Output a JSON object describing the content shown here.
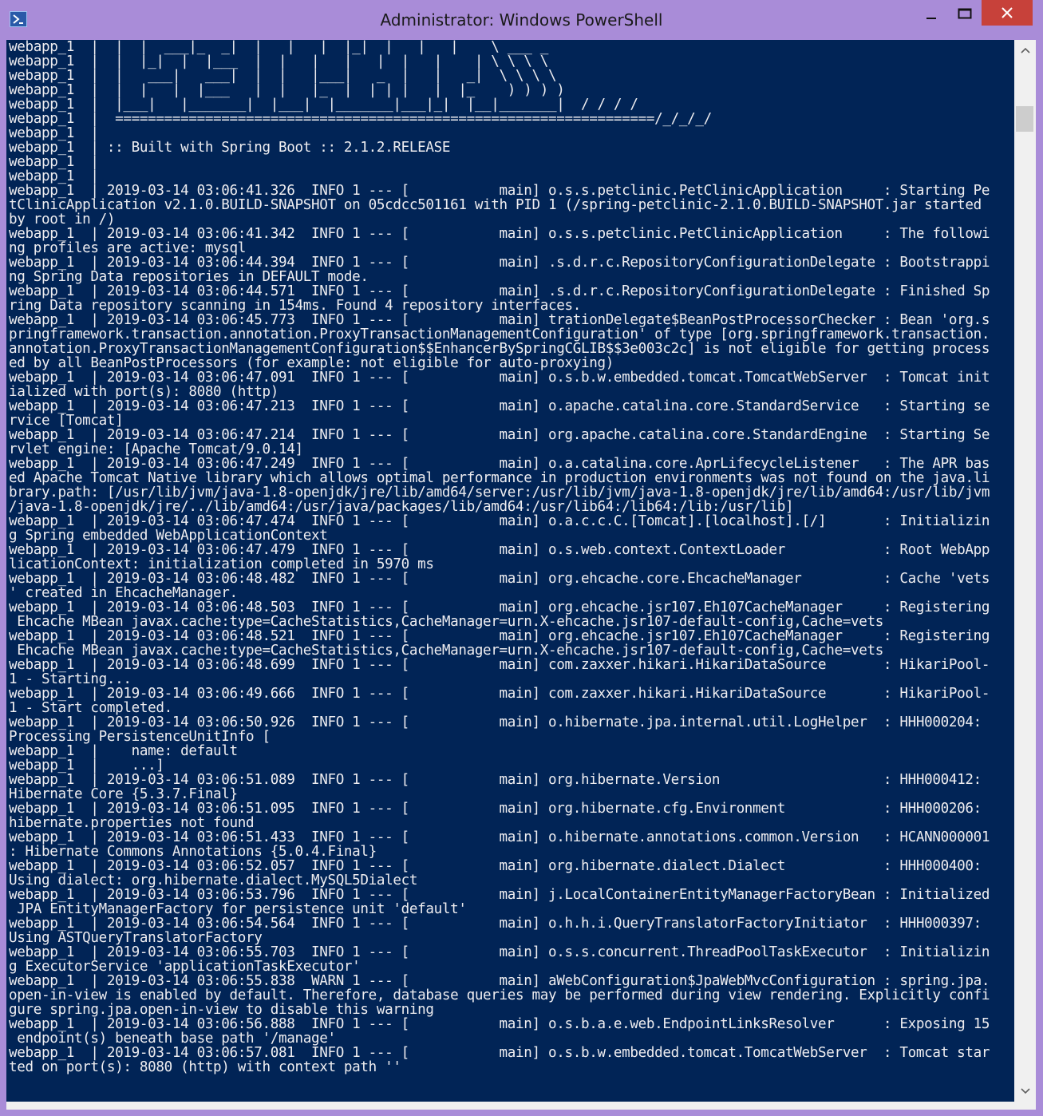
{
  "window": {
    "title": "Administrator: Windows PowerShell",
    "frame_color": "#a98cd8",
    "console_background": "#012456",
    "console_foreground": "#eeedf0",
    "close_color": "#c7413a"
  },
  "icons": {
    "app": "powershell-icon",
    "minimize": "minimize-icon",
    "maximize": "maximize-icon",
    "close": "close-icon",
    "scroll_up": "chevron-up-icon",
    "scroll_down": "chevron-down-icon"
  },
  "console_lines": [
    "webapp_1  |  |  |  ___|_  _|  |   |   |  |_|  |   |   |    \\ ___ _",
    "webapp_1  |  |  |_|  |  |___  |  |   |   |   |  |   |    | \\ \\ \\ \\",
    "webapp_1  |  |   ___|   ___|  |  |   |___|   _  |   |   _|  \\ \\ \\ \\",
    "webapp_1  |  |  |   |  |___   |  |   |_  |  | | |   |  |_    ) ) ) )",
    "webapp_1  |  |___|   |_______|  |___|  |_______|___|_|  |__|_______|  / / / /",
    "webapp_1  |  ==================================================================/_/_/_/",
    "webapp_1  |",
    "webapp_1  | :: Built with Spring Boot :: 2.1.2.RELEASE",
    "webapp_1  |",
    "webapp_1  |",
    "webapp_1  | 2019-03-14 03:06:41.326  INFO 1 --- [           main] o.s.s.petclinic.PetClinicApplication     : Starting Pe",
    "tClinicApplication v2.1.0.BUILD-SNAPSHOT on 05cdcc501161 with PID 1 (/spring-petclinic-2.1.0.BUILD-SNAPSHOT.jar started",
    "by root in /)",
    "webapp_1  | 2019-03-14 03:06:41.342  INFO 1 --- [           main] o.s.s.petclinic.PetClinicApplication     : The followi",
    "ng profiles are active: mysql",
    "webapp_1  | 2019-03-14 03:06:44.394  INFO 1 --- [           main] .s.d.r.c.RepositoryConfigurationDelegate : Bootstrappi",
    "ng Spring Data repositories in DEFAULT mode.",
    "webapp_1  | 2019-03-14 03:06:44.571  INFO 1 --- [           main] .s.d.r.c.RepositoryConfigurationDelegate : Finished Sp",
    "ring Data repository scanning in 154ms. Found 4 repository interfaces.",
    "webapp_1  | 2019-03-14 03:06:45.773  INFO 1 --- [           main] trationDelegate$BeanPostProcessorChecker : Bean 'org.s",
    "pringframework.transaction.annotation.ProxyTransactionManagementConfiguration' of type [org.springframework.transaction.",
    "annotation.ProxyTransactionManagementConfiguration$$EnhancerBySpringCGLIB$$3e003c2c] is not eligible for getting process",
    "ed by all BeanPostProcessors (for example: not eligible for auto-proxying)",
    "webapp_1  | 2019-03-14 03:06:47.091  INFO 1 --- [           main] o.s.b.w.embedded.tomcat.TomcatWebServer  : Tomcat init",
    "ialized with port(s): 8080 (http)",
    "webapp_1  | 2019-03-14 03:06:47.213  INFO 1 --- [           main] o.apache.catalina.core.StandardService   : Starting se",
    "rvice [Tomcat]",
    "webapp_1  | 2019-03-14 03:06:47.214  INFO 1 --- [           main] org.apache.catalina.core.StandardEngine  : Starting Se",
    "rvlet engine: [Apache Tomcat/9.0.14]",
    "webapp_1  | 2019-03-14 03:06:47.249  INFO 1 --- [           main] o.a.catalina.core.AprLifecycleListener   : The APR bas",
    "ed Apache Tomcat Native library which allows optimal performance in production environments was not found on the java.li",
    "brary.path: [/usr/lib/jvm/java-1.8-openjdk/jre/lib/amd64/server:/usr/lib/jvm/java-1.8-openjdk/jre/lib/amd64:/usr/lib/jvm",
    "/java-1.8-openjdk/jre/../lib/amd64:/usr/java/packages/lib/amd64:/usr/lib64:/lib64:/lib:/usr/lib]",
    "webapp_1  | 2019-03-14 03:06:47.474  INFO 1 --- [           main] o.a.c.c.C.[Tomcat].[localhost].[/]       : Initializin",
    "g Spring embedded WebApplicationContext",
    "webapp_1  | 2019-03-14 03:06:47.479  INFO 1 --- [           main] o.s.web.context.ContextLoader            : Root WebApp",
    "licationContext: initialization completed in 5970 ms",
    "webapp_1  | 2019-03-14 03:06:48.482  INFO 1 --- [           main] org.ehcache.core.EhcacheManager          : Cache 'vets",
    "' created in EhcacheManager.",
    "webapp_1  | 2019-03-14 03:06:48.503  INFO 1 --- [           main] org.ehcache.jsr107.Eh107CacheManager     : Registering",
    " Ehcache MBean javax.cache:type=CacheStatistics,CacheManager=urn.X-ehcache.jsr107-default-config,Cache=vets",
    "webapp_1  | 2019-03-14 03:06:48.521  INFO 1 --- [           main] org.ehcache.jsr107.Eh107CacheManager     : Registering",
    " Ehcache MBean javax.cache:type=CacheStatistics,CacheManager=urn.X-ehcache.jsr107-default-config,Cache=vets",
    "webapp_1  | 2019-03-14 03:06:48.699  INFO 1 --- [           main] com.zaxxer.hikari.HikariDataSource       : HikariPool-",
    "1 - Starting...",
    "webapp_1  | 2019-03-14 03:06:49.666  INFO 1 --- [           main] com.zaxxer.hikari.HikariDataSource       : HikariPool-",
    "1 - Start completed.",
    "webapp_1  | 2019-03-14 03:06:50.926  INFO 1 --- [           main] o.hibernate.jpa.internal.util.LogHelper  : HHH000204:",
    "Processing PersistenceUnitInfo [",
    "webapp_1  |    name: default",
    "webapp_1  |    ...]",
    "webapp_1  | 2019-03-14 03:06:51.089  INFO 1 --- [           main] org.hibernate.Version                    : HHH000412:",
    "Hibernate Core {5.3.7.Final}",
    "webapp_1  | 2019-03-14 03:06:51.095  INFO 1 --- [           main] org.hibernate.cfg.Environment            : HHH000206:",
    "hibernate.properties not found",
    "webapp_1  | 2019-03-14 03:06:51.433  INFO 1 --- [           main] o.hibernate.annotations.common.Version   : HCANN000001",
    ": Hibernate Commons Annotations {5.0.4.Final}",
    "webapp_1  | 2019-03-14 03:06:52.057  INFO 1 --- [           main] org.hibernate.dialect.Dialect            : HHH000400:",
    "Using dialect: org.hibernate.dialect.MySQL5Dialect",
    "webapp_1  | 2019-03-14 03:06:53.796  INFO 1 --- [           main] j.LocalContainerEntityManagerFactoryBean : Initialized",
    " JPA EntityManagerFactory for persistence unit 'default'",
    "webapp_1  | 2019-03-14 03:06:54.564  INFO 1 --- [           main] o.h.h.i.QueryTranslatorFactoryInitiator  : HHH000397:",
    "Using ASTQueryTranslatorFactory",
    "webapp_1  | 2019-03-14 03:06:55.703  INFO 1 --- [           main] o.s.s.concurrent.ThreadPoolTaskExecutor  : Initializin",
    "g ExecutorService 'applicationTaskExecutor'",
    "webapp_1  | 2019-03-14 03:06:55.838  WARN 1 --- [           main] aWebConfiguration$JpaWebMvcConfiguration : spring.jpa.",
    "open-in-view is enabled by default. Therefore, database queries may be performed during view rendering. Explicitly confi",
    "gure spring.jpa.open-in-view to disable this warning",
    "webapp_1  | 2019-03-14 03:06:56.888  INFO 1 --- [           main] o.s.b.a.e.web.EndpointLinksResolver      : Exposing 15",
    " endpoint(s) beneath base path '/manage'",
    "webapp_1  | 2019-03-14 03:06:57.081  INFO 1 --- [           main] o.s.b.w.embedded.tomcat.TomcatWebServer  : Tomcat star",
    "ted on port(s): 8080 (http) with context path ''"
  ]
}
